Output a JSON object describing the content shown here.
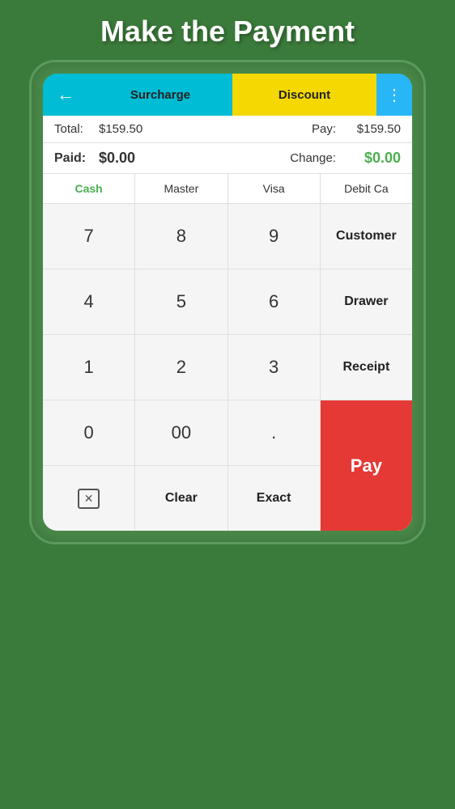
{
  "page": {
    "title": "Make the Payment"
  },
  "toolbar": {
    "back_icon": "←",
    "surcharge_label": "Surcharge",
    "discount_label": "Discount",
    "menu_icon": "⋮"
  },
  "summary": {
    "total_label": "Total:",
    "total_value": "$159.50",
    "pay_label": "Pay:",
    "pay_value": "$159.50",
    "paid_label": "Paid:",
    "paid_value": "$0.00",
    "change_label": "Change:",
    "change_value": "$0.00"
  },
  "payment_methods": [
    {
      "label": "Cash",
      "active": true
    },
    {
      "label": "Master",
      "active": false
    },
    {
      "label": "Visa",
      "active": false
    },
    {
      "label": "Debit Ca",
      "active": false
    }
  ],
  "numpad": {
    "rows": [
      [
        "7",
        "8",
        "9",
        "Customer"
      ],
      [
        "4",
        "5",
        "6",
        "Drawer"
      ],
      [
        "1",
        "2",
        "3",
        "Receipt"
      ],
      [
        "0",
        "00",
        ".",
        "Pay"
      ],
      [
        "⌫",
        "Clear",
        "Exact",
        ""
      ]
    ]
  }
}
